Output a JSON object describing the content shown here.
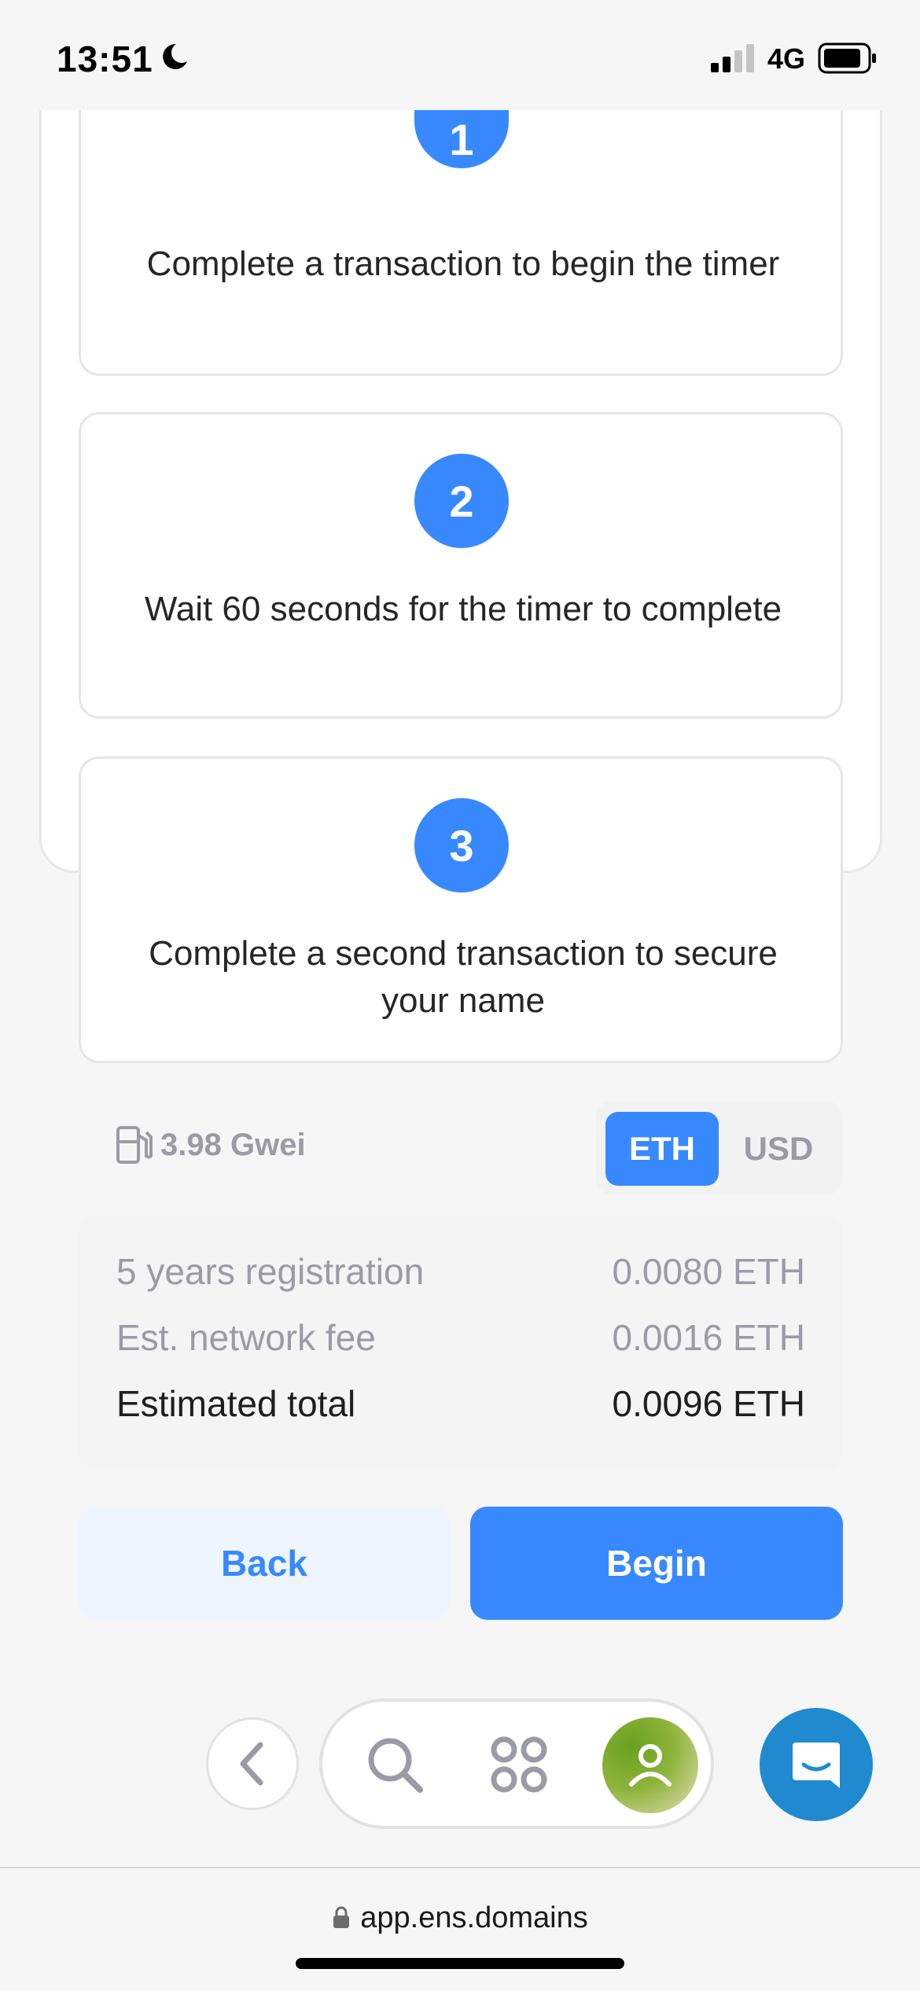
{
  "status_bar": {
    "time": "13:51",
    "network": "4G"
  },
  "steps": [
    {
      "number": "1",
      "text": "Complete a transaction to begin the timer"
    },
    {
      "number": "2",
      "text": "Wait 60 seconds for the timer to complete"
    },
    {
      "number": "3",
      "text": "Complete a second transaction to secure your name"
    }
  ],
  "gas": {
    "value": "3.98 Gwei",
    "icon": "gas-pump-icon"
  },
  "currency_toggle": {
    "options": [
      "ETH",
      "USD"
    ],
    "selected": "ETH"
  },
  "summary": {
    "rows": [
      {
        "label": "5 years registration",
        "value": "0.0080 ETH"
      },
      {
        "label": "Est. network fee",
        "value": "0.0016 ETH"
      },
      {
        "label": "Estimated total",
        "value": "0.0096 ETH"
      }
    ]
  },
  "buttons": {
    "back": "Back",
    "begin": "Begin"
  },
  "browser": {
    "url": "app.ens.domains"
  },
  "colors": {
    "accent": "#3889ff",
    "accent_light": "#eef5ff",
    "muted": "#9b9ba5",
    "chat": "#1f8ad0"
  }
}
